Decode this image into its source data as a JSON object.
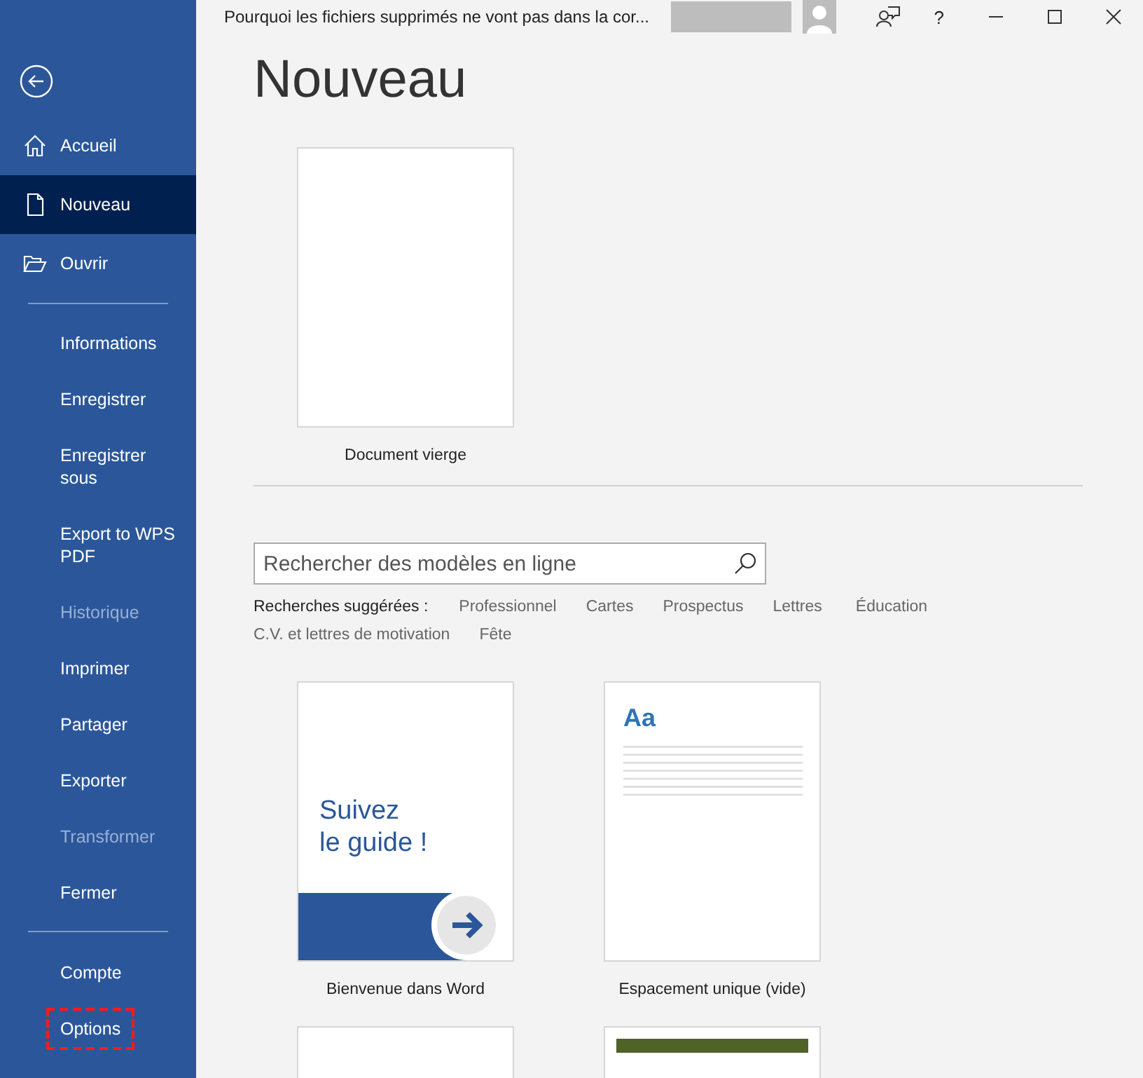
{
  "window": {
    "title": "Pourquoi les fichiers supprimés ne vont pas dans la cor...",
    "help": "?"
  },
  "sidebar": {
    "groups": [
      [
        {
          "label": "Accueil",
          "kind": "home",
          "selected": false,
          "disabled": false
        },
        {
          "label": "Nouveau",
          "kind": "new",
          "selected": true,
          "disabled": false
        },
        {
          "label": "Ouvrir",
          "kind": "open",
          "selected": false,
          "disabled": false
        }
      ],
      [
        {
          "label": "Informations",
          "kind": "text",
          "selected": false,
          "disabled": false
        },
        {
          "label": "Enregistrer",
          "kind": "text",
          "selected": false,
          "disabled": false
        },
        {
          "label": "Enregistrer sous",
          "kind": "text",
          "selected": false,
          "disabled": false
        },
        {
          "label": "Export to WPS PDF",
          "kind": "text",
          "selected": false,
          "disabled": false
        },
        {
          "label": "Historique",
          "kind": "text",
          "selected": false,
          "disabled": true
        },
        {
          "label": "Imprimer",
          "kind": "text",
          "selected": false,
          "disabled": false
        },
        {
          "label": "Partager",
          "kind": "text",
          "selected": false,
          "disabled": false
        },
        {
          "label": "Exporter",
          "kind": "text",
          "selected": false,
          "disabled": false
        },
        {
          "label": "Transformer",
          "kind": "text",
          "selected": false,
          "disabled": true
        },
        {
          "label": "Fermer",
          "kind": "text",
          "selected": false,
          "disabled": false
        }
      ],
      [
        {
          "label": "Compte",
          "kind": "text",
          "selected": false,
          "disabled": false
        },
        {
          "label": "Options",
          "kind": "text",
          "selected": false,
          "disabled": false,
          "highlighted": true
        }
      ]
    ]
  },
  "heading": "Nouveau",
  "blank_document": {
    "label": "Document vierge"
  },
  "search": {
    "placeholder": "Rechercher des modèles en ligne"
  },
  "suggested": {
    "label": "Recherches suggérées :",
    "links": [
      "Professionnel",
      "Cartes",
      "Prospectus",
      "Lettres",
      "Éducation",
      "C.V. et lettres de motivation",
      "Fête"
    ]
  },
  "templates": [
    {
      "kind": "guide",
      "label": "Bienvenue dans Word",
      "lines": [
        "Suivez",
        "le guide !"
      ]
    },
    {
      "kind": "spacing",
      "label": "Espacement unique (vide)",
      "sample": "Aa"
    },
    {
      "kind": "plain"
    },
    {
      "kind": "banner"
    }
  ]
}
